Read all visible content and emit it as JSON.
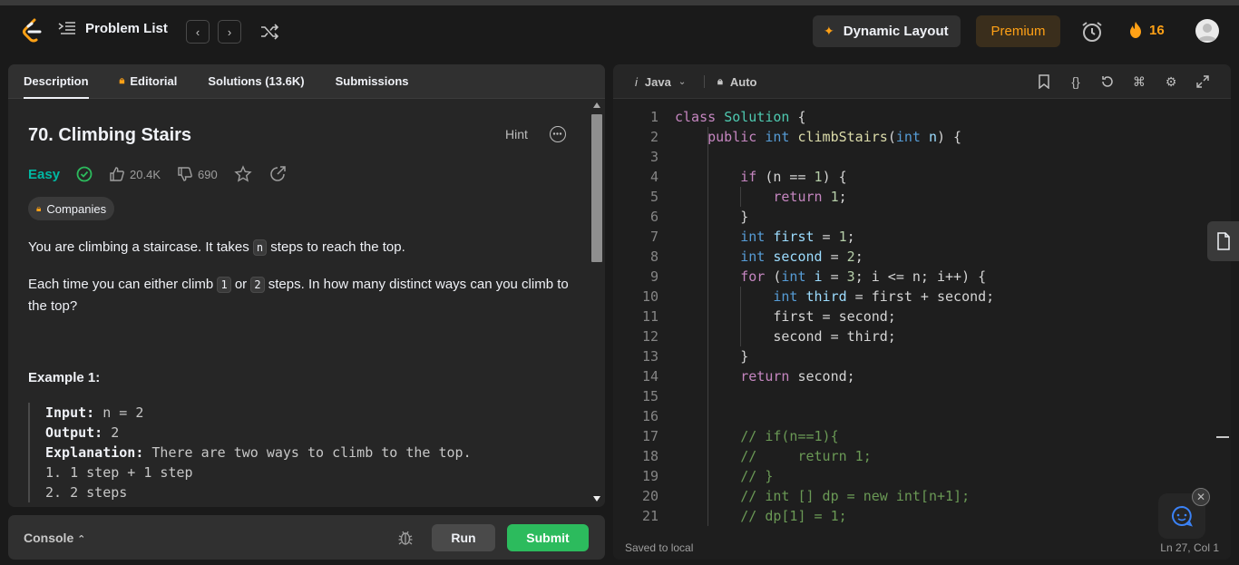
{
  "nav": {
    "problem_list": "Problem List",
    "dynamic_layout": "Dynamic Layout",
    "premium": "Premium",
    "streak": "16"
  },
  "tabs": [
    {
      "label": "Description"
    },
    {
      "label": "Editorial"
    },
    {
      "label": "Solutions (13.6K)"
    },
    {
      "label": "Submissions"
    }
  ],
  "problem": {
    "title": "70. Climbing Stairs",
    "hint": "Hint",
    "difficulty": "Easy",
    "likes": "20.4K",
    "dislikes": "690",
    "companies": "Companies",
    "p1_a": "You are climbing a staircase. It takes ",
    "p1_code": "n",
    "p1_b": " steps to reach the top.",
    "p2_a": "Each time you can either climb ",
    "p2_code1": "1",
    "p2_mid": " or ",
    "p2_code2": "2",
    "p2_b": " steps. In how many distinct ways can you climb to the top?",
    "example_title": "Example 1:",
    "input_label": "Input:",
    "input_value": " n = 2",
    "output_label": "Output:",
    "output_value": " 2",
    "expl_label": "Explanation:",
    "expl_value": " There are two ways to climb to the top.",
    "step1": "1. 1 step + 1 step",
    "step2": "2. 2 steps"
  },
  "console": {
    "label": "Console",
    "run": "Run",
    "submit": "Submit"
  },
  "editor": {
    "language": "Java",
    "mode": "Auto",
    "saved": "Saved to local",
    "position": "Ln 27, Col 1"
  },
  "code_lines": [
    "class Solution {",
    "    public int climbStairs(int n) {",
    "",
    "        if (n == 1) {",
    "            return 1;",
    "        }",
    "        int first = 1;",
    "        int second = 2;",
    "        for (int i = 3; i <= n; i++) {",
    "            int third = first + second;",
    "            first = second;",
    "            second = third;",
    "        }",
    "        return second;",
    "",
    "",
    "        // if(n==1){",
    "        //     return 1;",
    "        // }",
    "        // int [] dp = new int[n+1];",
    "        // dp[1] = 1;"
  ],
  "colors": {
    "accent_orange": "#ffa116",
    "easy_green": "#00b8a3",
    "submit_green": "#2cbb5d"
  }
}
